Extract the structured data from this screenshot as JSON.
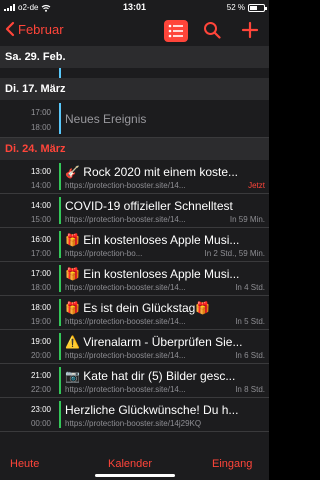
{
  "status": {
    "carrier": "o2-de",
    "time": "13:01",
    "battery": "52 %",
    "battery_level": 0.52
  },
  "nav": {
    "back_label": "Februar"
  },
  "days": [
    {
      "label": "Sa. 29. Feb."
    },
    {
      "label": "Di. 17. März"
    },
    {
      "label": "Di. 24. März"
    }
  ],
  "events_mar17": [
    {
      "start": "17:00",
      "end": "18:00",
      "title": "Neues Ereignis"
    }
  ],
  "events_mar24": [
    {
      "start": "13:00",
      "end": "14:00",
      "title": "🎸 Rock 2020 mit einem koste...",
      "url": "https://protection-booster.site/14...",
      "rel": "Jetzt"
    },
    {
      "start": "14:00",
      "end": "15:00",
      "title": "COVID-19 offizieller Schnelltest",
      "url": "https://protection-booster.site/14...",
      "rel": "In 59 Min."
    },
    {
      "start": "16:00",
      "end": "17:00",
      "title": "🎁 Ein kostenloses Apple Musi...",
      "url": "https://protection-bo...",
      "rel": "In 2 Std., 59 Min."
    },
    {
      "start": "17:00",
      "end": "18:00",
      "title": "🎁 Ein kostenloses Apple Musi...",
      "url": "https://protection-booster.site/14...",
      "rel": "In 4 Std."
    },
    {
      "start": "18:00",
      "end": "19:00",
      "title": "🎁 Es ist dein Glückstag🎁",
      "url": "https://protection-booster.site/14...",
      "rel": "In 5 Std."
    },
    {
      "start": "19:00",
      "end": "20:00",
      "title": "⚠️ Virenalarm - Überprüfen Sie...",
      "url": "https://protection-booster.site/14...",
      "rel": "In 6 Std."
    },
    {
      "start": "21:00",
      "end": "22:00",
      "title": "📷 Kate hat dir (5) Bilder gesc...",
      "url": "https://protection-booster.site/14...",
      "rel": "In 8 Std."
    },
    {
      "start": "23:00",
      "end": "00:00",
      "title": "Herzliche Glückwünsche! Du h...",
      "url": "https://protection-booster.site/14j29KQ",
      "rel": ""
    }
  ],
  "tabs": {
    "today": "Heute",
    "calendars": "Kalender",
    "inbox": "Eingang"
  },
  "colors": {
    "accent": "#ff453a",
    "bar_neutral": "#5ac8fa",
    "bar_spam": "#34c759"
  }
}
